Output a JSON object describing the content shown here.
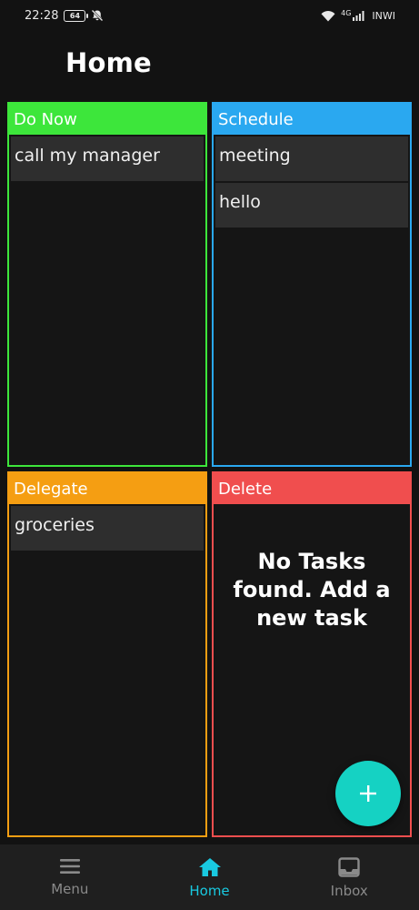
{
  "status_bar": {
    "time": "22:28",
    "battery": "64",
    "network": "4G",
    "carrier": "INWI"
  },
  "header": {
    "title": "Home"
  },
  "quadrants": {
    "do_now": {
      "title": "Do Now",
      "color": "#3de63b",
      "tasks": [
        "call my manager"
      ]
    },
    "schedule": {
      "title": "Schedule",
      "color": "#2aa8f0",
      "tasks": [
        "meeting",
        "hello"
      ]
    },
    "delegate": {
      "title": "Delegate",
      "color": "#f59e12",
      "tasks": [
        "groceries"
      ]
    },
    "delete": {
      "title": "Delete",
      "color": "#f04e4e",
      "empty_message": "No Tasks found. Add a new task"
    }
  },
  "fab": {
    "icon": "plus-icon",
    "color": "#15d2c3"
  },
  "bottom_nav": {
    "items": [
      {
        "label": "Menu",
        "icon": "menu-icon"
      },
      {
        "label": "Home",
        "icon": "home-icon",
        "active": true
      },
      {
        "label": "Inbox",
        "icon": "inbox-icon"
      }
    ],
    "active_color": "#19c9e0"
  }
}
